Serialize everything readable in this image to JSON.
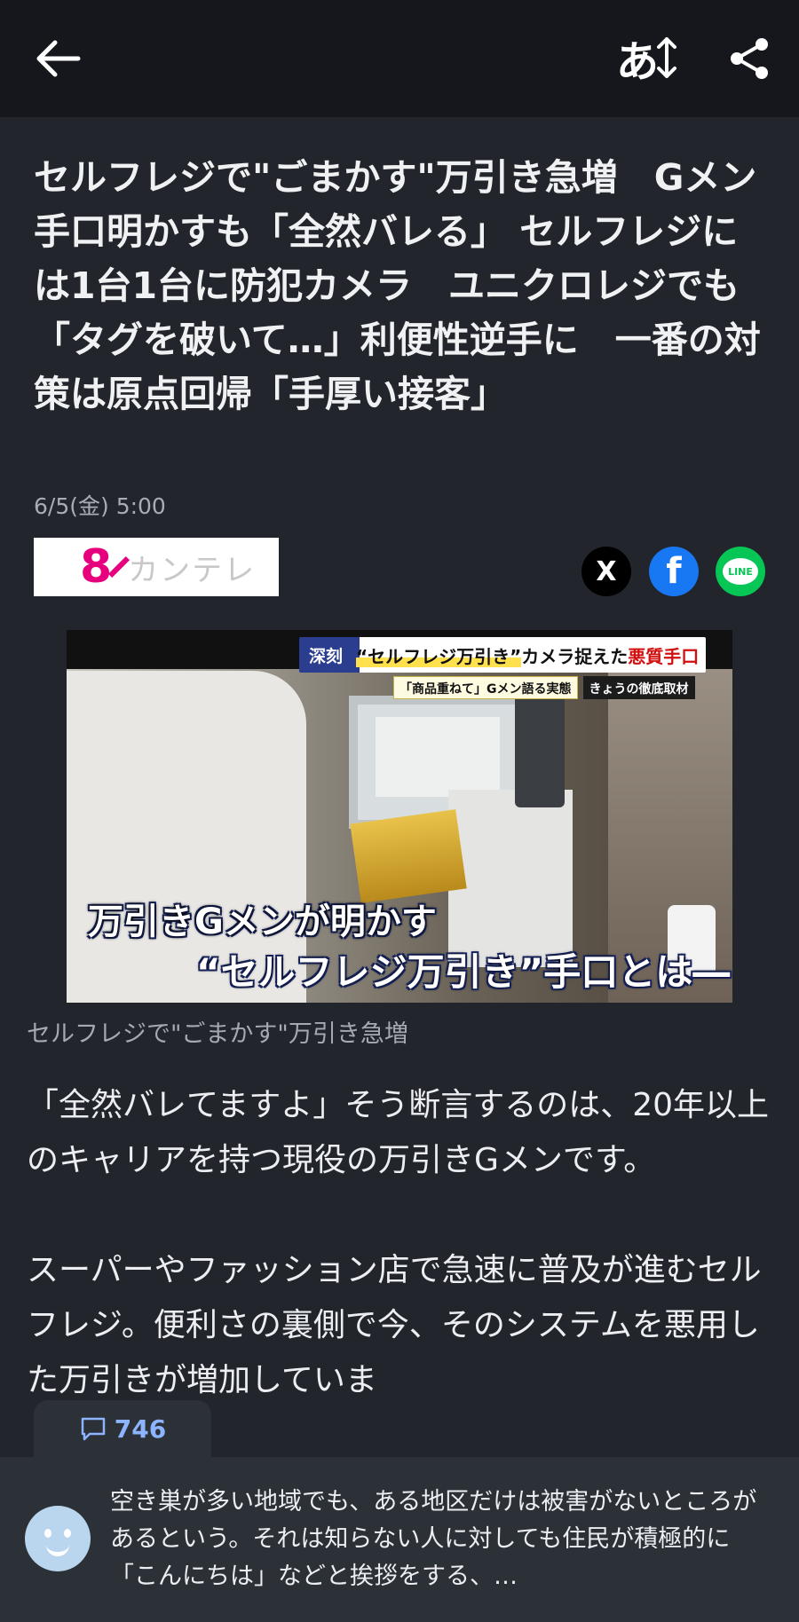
{
  "header": {
    "back_icon": "arrow-left-icon",
    "font_size_label": "あ",
    "font_size_icon": "vertical-arrows-icon",
    "share_icon": "share-icon"
  },
  "article": {
    "title": "セルフレジで\"ごまかす\"万引き急増　Gメン手口明かすも「全然バレる」 セルフレジには1台1台に防犯カメラ　ユニクロレジでも「タグを破いて…」利便性逆手に　一番の対策は原点回帰「手厚い接客」",
    "date": "6/5(金) 5:00",
    "source_logo_mark": "8",
    "source_logo_text": "カンテレ",
    "share_buttons": [
      "X",
      "f",
      "LINE"
    ]
  },
  "image": {
    "banner_tag": "深刻",
    "banner_main": "“セルフレジ万引き”",
    "banner_mid": "カメラ捉えた",
    "banner_red": "悪質手口",
    "sub_banner_1": "「商品重ねて」Gメン語る実態",
    "sub_banner_2": "きょうの徹底取材",
    "caption_line_1": "万引きGメンが明かす",
    "caption_line_2": "“セルフレジ万引き”手口とは―",
    "caption": "セルフレジで\"ごまかす\"万引き急増"
  },
  "body": {
    "paragraph_1": "「全然バレてますよ」そう断言するのは、20年以上のキャリアを持つ現役の万引きGメンです。",
    "paragraph_2": "スーパーやファッション店で急速に普及が進むセルフレジ。便利さの裏側で今、そのシステムを悪用した万引きが増加していま"
  },
  "comments": {
    "icon": "comment-icon",
    "count": "746"
  },
  "bottom_comment": {
    "avatar_icon": "smiley-avatar-icon",
    "text": "空き巣が多い地域でも、ある地区だけは被害がないところがあるという。それは知らない人に対しても住民が積極的に「こんにちは」などと挨拶をする、…"
  }
}
